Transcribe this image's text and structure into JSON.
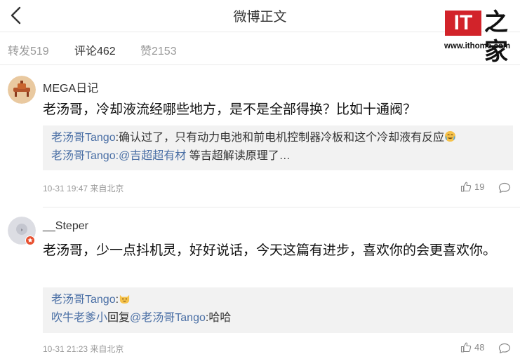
{
  "header": {
    "title": "微博正文",
    "logo_text": "IT之家",
    "logo_it": "IT",
    "logo_zh": "之家",
    "logo_url": "www.ithome.com"
  },
  "tabs": [
    {
      "label": "转发519",
      "active": false
    },
    {
      "label": "评论462",
      "active": true
    },
    {
      "label": "赞2153",
      "active": false
    }
  ],
  "comments": [
    {
      "username": "MEGA日记",
      "content": "老汤哥，冷却液流经哪些地方，是不是全部得换？比如十通阀？",
      "replies": [
        {
          "author": "老汤哥Tango",
          "sep": ":",
          "text": "确认过了，只有动力电池和前电机控制器冷板和这个冷却液有反应",
          "emoji": "crying-laughing-emoji"
        },
        {
          "author": "老汤哥Tango",
          "sep": ":",
          "mention": "@吉超超有材",
          "text": " 等吉超解读原理了…"
        }
      ],
      "time": "10-31 19:47",
      "location": "来自北京",
      "likes": "19"
    },
    {
      "username": "__Steper",
      "content": "老汤哥，少一点抖机灵，好好说话，今天这篇有进步，喜欢你的会更喜欢你。",
      "replies": [
        {
          "author": "老汤哥Tango",
          "sep": ":",
          "emoji": "cat-face-emoji"
        },
        {
          "author": "吹牛老爹小",
          "reply_word": "回复",
          "mention": "@老汤哥Tango",
          "text": ":哈哈"
        }
      ],
      "time": "10-31 21:23",
      "location": "来自北京",
      "likes": "48"
    }
  ],
  "colors": {
    "link": "#4a6fa5",
    "reply_bg": "#f2f2f2",
    "meta": "#999999",
    "logo_red": "#d2232a"
  },
  "icons": [
    "back-arrow-icon",
    "thumb-up-icon",
    "comment-bubble-icon",
    "verified-badge-icon"
  ]
}
